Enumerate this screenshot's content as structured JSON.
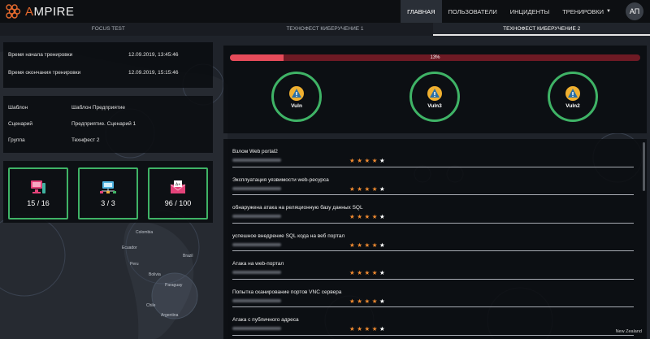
{
  "app": {
    "brand": "AMPIRE",
    "brand_accent": "A",
    "user_initials": "АП"
  },
  "nav": [
    {
      "label": "ГЛАВНАЯ",
      "active": true
    },
    {
      "label": "ПОЛЬЗОВАТЕЛИ",
      "active": false
    },
    {
      "label": "ИНЦИДЕНТЫ",
      "active": false
    },
    {
      "label": "ТРЕНИРОВКИ",
      "active": false,
      "dropdown": true
    }
  ],
  "tabs": [
    {
      "label": "FOCUS TEST",
      "active": false
    },
    {
      "label": "ТЕХНОФЕСТ КИБЕРУЧЕНИЕ 1",
      "active": false
    },
    {
      "label": "ТЕХНОФЕСТ КИБЕРУЧЕНИЕ 2",
      "active": true
    }
  ],
  "times": [
    {
      "label": "Время начала тренировки",
      "value": "12.09.2019, 13:45:46"
    },
    {
      "label": "Время окончания тренировки",
      "value": "12.09.2019, 15:15:46"
    }
  ],
  "info": [
    {
      "label": "Шаблон",
      "value": "Шаблон Предприятие"
    },
    {
      "label": "Сценарий",
      "value": "Предприятие. Сценарий 1"
    },
    {
      "label": "Группа",
      "value": "Технфест 2"
    }
  ],
  "stats": [
    {
      "icon": "monitor-icon",
      "value": "15 / 16"
    },
    {
      "icon": "network-icon",
      "value": "3 / 3"
    },
    {
      "icon": "grade-mail-icon",
      "value": "96 / 100"
    }
  ],
  "progress": {
    "percent_label": "13%",
    "value": 0.13
  },
  "vulns": [
    {
      "label": "Vuln"
    },
    {
      "label": "Vuln3"
    },
    {
      "label": "Vuln2"
    }
  ],
  "events": [
    {
      "title": "Взлом Web portal2",
      "rating": 4
    },
    {
      "title": "Эксплуатация уязвимости web-ресурса",
      "rating": 4
    },
    {
      "title": "обнаружена атака на реляционную базу данных SQL",
      "rating": 4
    },
    {
      "title": "успешное внедрение SQL кода на веб портал",
      "rating": 4
    },
    {
      "title": "Атака на web-портал",
      "rating": 4
    },
    {
      "title": "Попытка сканирование портов VNC сервера",
      "rating": 4
    },
    {
      "title": "Атака с публичного адреса",
      "rating": 4
    }
  ],
  "map_labels": {
    "colombia": "Colombia",
    "ecuador": "Ecuador",
    "peru": "Peru",
    "bolivia": "Bolivia",
    "brazil": "Brazil",
    "paraguay": "Paraguay",
    "chile": "Chile",
    "argentina": "Argentina",
    "new_zealand": "New Zealand"
  },
  "colors": {
    "accent_green": "#3fb366",
    "progress_red": "#e64b5a",
    "star_orange": "#f08a30"
  }
}
